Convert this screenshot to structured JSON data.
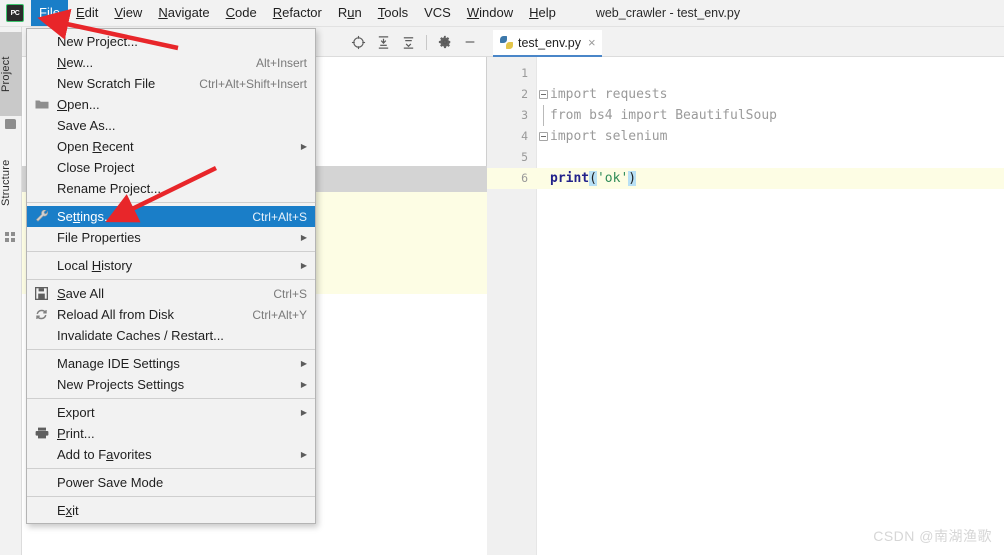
{
  "window": {
    "title": "web_crawler - test_env.py",
    "app_logo_text": "PC"
  },
  "menubar": {
    "items": [
      {
        "label": "File",
        "mnemonic": "F",
        "active": true
      },
      {
        "label": "Edit",
        "mnemonic": "E",
        "active": false
      },
      {
        "label": "View",
        "mnemonic": "V",
        "active": false
      },
      {
        "label": "Navigate",
        "mnemonic": "N",
        "active": false
      },
      {
        "label": "Code",
        "mnemonic": "C",
        "active": false
      },
      {
        "label": "Refactor",
        "mnemonic": "R",
        "active": false
      },
      {
        "label": "Run",
        "mnemonic": "u",
        "active": false
      },
      {
        "label": "Tools",
        "mnemonic": "T",
        "active": false
      },
      {
        "label": "VCS",
        "mnemonic": "",
        "active": false
      },
      {
        "label": "Window",
        "mnemonic": "W",
        "active": false
      },
      {
        "label": "Help",
        "mnemonic": "H",
        "active": false
      }
    ]
  },
  "file_menu": {
    "rows": [
      {
        "type": "item",
        "label": "New Project...",
        "accel": "",
        "icon": "",
        "arrow": false,
        "selected": false,
        "mn": ""
      },
      {
        "type": "item",
        "label": "New...",
        "accel": "Alt+Insert",
        "icon": "",
        "arrow": false,
        "selected": false,
        "mn": "N"
      },
      {
        "type": "item",
        "label": "New Scratch File",
        "accel": "Ctrl+Alt+Shift+Insert",
        "icon": "",
        "arrow": false,
        "selected": false,
        "mn": ""
      },
      {
        "type": "item",
        "label": "Open...",
        "accel": "",
        "icon": "folder-icon",
        "arrow": false,
        "selected": false,
        "mn": "O"
      },
      {
        "type": "item",
        "label": "Save As...",
        "accel": "",
        "icon": "",
        "arrow": false,
        "selected": false,
        "mn": ""
      },
      {
        "type": "item",
        "label": "Open Recent",
        "accel": "",
        "icon": "",
        "arrow": true,
        "selected": false,
        "mn": "R"
      },
      {
        "type": "item",
        "label": "Close Project",
        "accel": "",
        "icon": "",
        "arrow": false,
        "selected": false,
        "mn": ""
      },
      {
        "type": "item",
        "label": "Rename Project...",
        "accel": "",
        "icon": "",
        "arrow": false,
        "selected": false,
        "mn": ""
      },
      {
        "type": "sep"
      },
      {
        "type": "item",
        "label": "Settings...",
        "accel": "Ctrl+Alt+S",
        "icon": "wrench-icon",
        "arrow": false,
        "selected": true,
        "mn": "tt"
      },
      {
        "type": "item",
        "label": "File Properties",
        "accel": "",
        "icon": "",
        "arrow": true,
        "selected": false,
        "mn": ""
      },
      {
        "type": "sep"
      },
      {
        "type": "item",
        "label": "Local History",
        "accel": "",
        "icon": "",
        "arrow": true,
        "selected": false,
        "mn": "H"
      },
      {
        "type": "sep"
      },
      {
        "type": "item",
        "label": "Save All",
        "accel": "Ctrl+S",
        "icon": "save-icon",
        "arrow": false,
        "selected": false,
        "mn": "S"
      },
      {
        "type": "item",
        "label": "Reload All from Disk",
        "accel": "Ctrl+Alt+Y",
        "icon": "reload-icon",
        "arrow": false,
        "selected": false,
        "mn": ""
      },
      {
        "type": "item",
        "label": "Invalidate Caches / Restart...",
        "accel": "",
        "icon": "",
        "arrow": false,
        "selected": false,
        "mn": ""
      },
      {
        "type": "sep"
      },
      {
        "type": "item",
        "label": "Manage IDE Settings",
        "accel": "",
        "icon": "",
        "arrow": true,
        "selected": false,
        "mn": ""
      },
      {
        "type": "item",
        "label": "New Projects Settings",
        "accel": "",
        "icon": "",
        "arrow": true,
        "selected": false,
        "mn": ""
      },
      {
        "type": "sep"
      },
      {
        "type": "item",
        "label": "Export",
        "accel": "",
        "icon": "",
        "arrow": true,
        "selected": false,
        "mn": ""
      },
      {
        "type": "item",
        "label": "Print...",
        "accel": "",
        "icon": "print-icon",
        "arrow": false,
        "selected": false,
        "mn": "P"
      },
      {
        "type": "item",
        "label": "Add to Favorites",
        "accel": "",
        "icon": "",
        "arrow": true,
        "selected": false,
        "mn": "a"
      },
      {
        "type": "sep"
      },
      {
        "type": "item",
        "label": "Power Save Mode",
        "accel": "",
        "icon": "",
        "arrow": false,
        "selected": false,
        "mn": ""
      },
      {
        "type": "sep"
      },
      {
        "type": "item",
        "label": "Exit",
        "accel": "",
        "icon": "",
        "arrow": false,
        "selected": false,
        "mn": "x"
      }
    ]
  },
  "left_strip": {
    "tabs": [
      {
        "label": "Project",
        "icon": "folder-icon",
        "selected": true
      },
      {
        "label": "Structure",
        "icon": "structure-icon",
        "selected": false
      }
    ]
  },
  "project_panel": {
    "toolbar": [
      {
        "name": "locate-icon",
        "glyph": "locate"
      },
      {
        "name": "expand-all-icon",
        "glyph": "expand"
      },
      {
        "name": "collapse-all-icon",
        "glyph": "collapse"
      },
      {
        "name": "gear-icon",
        "glyph": "gear"
      },
      {
        "name": "hide-icon",
        "glyph": "minus"
      }
    ]
  },
  "editor": {
    "tab": {
      "label": "test_env.py",
      "icon": "python-file-icon",
      "close_label": "×"
    },
    "lines": [
      {
        "num": "1",
        "segments": [],
        "highlight": false,
        "fold": "none"
      },
      {
        "num": "2",
        "segments": [
          {
            "text": "import requests",
            "cls": "kw-grey"
          }
        ],
        "highlight": false,
        "fold": "start"
      },
      {
        "num": "3",
        "segments": [
          {
            "text": "from bs4 import BeautifulSoup",
            "cls": "kw-grey"
          }
        ],
        "highlight": false,
        "fold": "body"
      },
      {
        "num": "4",
        "segments": [
          {
            "text": "import selenium",
            "cls": "kw-grey"
          }
        ],
        "highlight": false,
        "fold": "end"
      },
      {
        "num": "5",
        "segments": [],
        "highlight": false,
        "fold": "none"
      },
      {
        "num": "6",
        "segments": [
          {
            "text": "print",
            "cls": "kw-print"
          },
          {
            "text": "(",
            "cls": "paren"
          },
          {
            "text": "'ok'",
            "cls": "str"
          },
          {
            "text": ")",
            "cls": "paren"
          }
        ],
        "highlight": true,
        "fold": "none"
      }
    ]
  },
  "annotations": {
    "arrow_1_target": "File menu",
    "arrow_2_target": "Settings... menu item",
    "color": "#e8262a"
  },
  "watermark": {
    "text": "CSDN @南湖渔歌"
  },
  "colors": {
    "accent_blue": "#1a7ec8",
    "menu_bg": "#f2f2f2",
    "highlight_line": "#fdfde4",
    "selected_row": "#d4d4d4"
  }
}
